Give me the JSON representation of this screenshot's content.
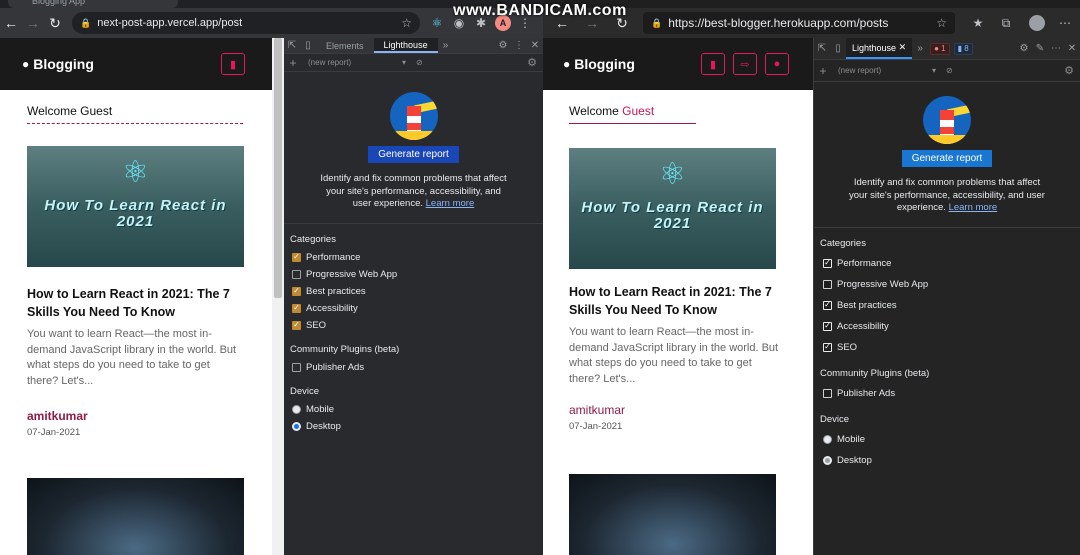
{
  "watermark": "www.BANDICAM.com",
  "left": {
    "tab_title": "Blogging App",
    "url": "next-post-app.vercel.app/post",
    "profile_initial": "A",
    "site": {
      "brand": "Blogging",
      "welcome_prefix": "Welcome",
      "welcome_name": "Guest",
      "hero_text": "How To Learn React in 2021",
      "post_title": "How to Learn React in 2021: The 7 Skills You Need To Know",
      "excerpt": "You want to learn React—the most in-demand JavaScript library in the world. But what steps do you need to take to get there? Let's...",
      "author": "amitkumar",
      "date": "07-Jan-2021"
    },
    "devtools": {
      "tabs": [
        "Elements",
        "Lighthouse"
      ],
      "active_tab": "Lighthouse",
      "report_select": "(new report)",
      "generate_label": "Generate report",
      "description": "Identify and fix common problems that affect your site's performance, accessibility, and user experience.",
      "learn_more": "Learn more",
      "categories_label": "Categories",
      "categories": [
        {
          "label": "Performance",
          "checked": true
        },
        {
          "label": "Progressive Web App",
          "checked": false
        },
        {
          "label": "Best practices",
          "checked": true
        },
        {
          "label": "Accessibility",
          "checked": true
        },
        {
          "label": "SEO",
          "checked": true
        }
      ],
      "plugins_label": "Community Plugins (beta)",
      "plugins": [
        {
          "label": "Publisher Ads",
          "checked": false
        }
      ],
      "device_label": "Device",
      "devices": [
        {
          "label": "Mobile",
          "selected": false
        },
        {
          "label": "Desktop",
          "selected": true
        }
      ]
    }
  },
  "right": {
    "url": "https://best-blogger.herokuapp.com/posts",
    "site": {
      "brand": "Blogging",
      "welcome_prefix": "Welcome",
      "welcome_name": "Guest",
      "hero_text": "How To Learn React in 2021",
      "post_title": "How to Learn React in 2021: The 7 Skills You Need To Know",
      "excerpt": "You want to learn React—the most in-demand JavaScript library in the world. But what steps do you need to take to get there? Let's...",
      "author": "amitkumar",
      "date": "07-Jan-2021"
    },
    "devtools": {
      "active_tab": "Lighthouse",
      "error_count": "1",
      "message_count": "8",
      "report_select": "(new report)",
      "generate_label": "Generate report",
      "description": "Identify and fix common problems that affect your site's performance, accessibility, and user experience.",
      "learn_more": "Learn more",
      "categories_label": "Categories",
      "categories": [
        {
          "label": "Performance",
          "checked": true
        },
        {
          "label": "Progressive Web App",
          "checked": false
        },
        {
          "label": "Best practices",
          "checked": true
        },
        {
          "label": "Accessibility",
          "checked": true
        },
        {
          "label": "SEO",
          "checked": true
        }
      ],
      "plugins_label": "Community Plugins (beta)",
      "plugins": [
        {
          "label": "Publisher Ads",
          "checked": false
        }
      ],
      "device_label": "Device",
      "devices": [
        {
          "label": "Mobile",
          "selected": false
        },
        {
          "label": "Desktop",
          "selected": true
        }
      ]
    }
  }
}
